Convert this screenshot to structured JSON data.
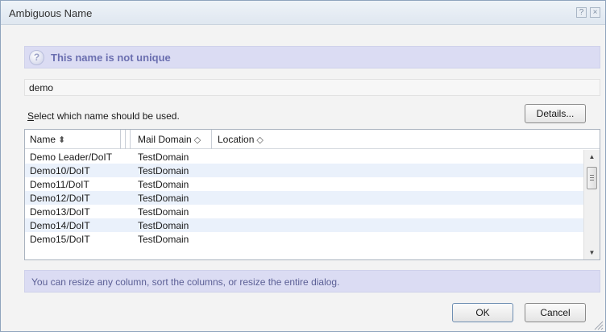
{
  "window": {
    "title": "Ambiguous Name",
    "help_glyph": "?",
    "close_glyph": "×"
  },
  "info": {
    "icon": "question-mark-icon",
    "icon_glyph": "?",
    "message": "This name is not unique"
  },
  "name_field": {
    "value": "demo"
  },
  "select_prompt": {
    "accel": "S",
    "rest": "elect which name should be used."
  },
  "details_button": {
    "label": "Details..."
  },
  "table": {
    "columns": [
      {
        "label": "Name",
        "sort_glyph": "⬍"
      },
      {
        "label": "Mail Domain",
        "sort_glyph": "◇"
      },
      {
        "label": "Location",
        "sort_glyph": "◇"
      }
    ],
    "rows": [
      {
        "name": "Demo Leader/DoIT",
        "domain": "TestDomain"
      },
      {
        "name": "Demo10/DoIT",
        "domain": "TestDomain"
      },
      {
        "name": "Demo11/DoIT",
        "domain": "TestDomain"
      },
      {
        "name": "Demo12/DoIT",
        "domain": "TestDomain"
      },
      {
        "name": "Demo13/DoIT",
        "domain": "TestDomain"
      },
      {
        "name": "Demo14/DoIT",
        "domain": "TestDomain"
      },
      {
        "name": "Demo15/DoIT",
        "domain": "TestDomain"
      }
    ]
  },
  "hint": {
    "text": "You can resize any column, sort the columns, or resize the entire dialog."
  },
  "buttons": {
    "ok": "OK",
    "cancel": "Cancel"
  },
  "colors": {
    "banner_bg": "#dbdcf3",
    "banner_text": "#6b6fb0",
    "row_alt": "#eaf1fb"
  }
}
